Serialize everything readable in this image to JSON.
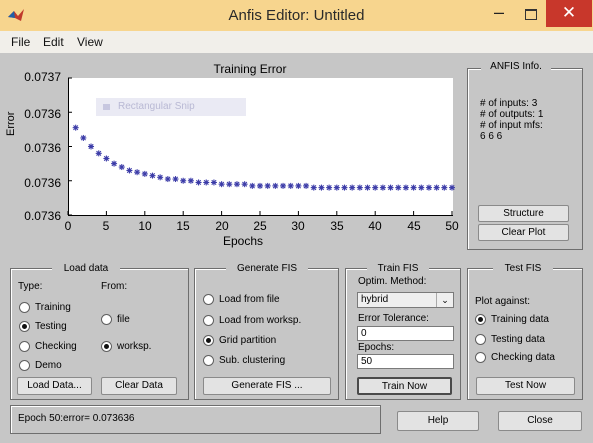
{
  "window": {
    "title": "Anfis Editor: Untitled",
    "minimize_glyph": "–",
    "close_glyph": "✕"
  },
  "menu": [
    "File",
    "Edit",
    "View"
  ],
  "colors": {
    "titlebar": "#f7d58e",
    "close": "#c8372b",
    "marker": "#3c3ca8",
    "background": "#c6c6c6"
  },
  "snip_overlay": {
    "label": "Rectangular Snip"
  },
  "chart_data": {
    "type": "scatter",
    "title": "Training Error",
    "xlabel": "Epochs",
    "ylabel": "Error",
    "xlim": [
      0,
      50
    ],
    "x_ticks": [
      "0",
      "5",
      "10",
      "15",
      "20",
      "25",
      "30",
      "35",
      "40",
      "45",
      "50"
    ],
    "y_tick_labels": [
      "0.0737",
      "0.0736",
      "0.0736",
      "0.0736",
      "0.0736"
    ],
    "ylim": [
      0.0736,
      0.07368
    ],
    "marker": "asterisk",
    "series": [
      {
        "x": [
          1,
          2,
          3,
          4,
          5,
          6,
          7,
          8,
          9,
          10,
          11,
          12,
          13,
          14,
          15,
          16,
          17,
          18,
          19,
          20,
          21,
          22,
          23,
          24,
          25,
          26,
          27,
          28,
          29,
          30,
          31,
          32,
          33,
          34,
          35,
          36,
          37,
          38,
          39,
          40,
          41,
          42,
          43,
          44,
          45,
          46,
          47,
          48,
          49,
          50
        ],
        "y": [
          0.073651,
          0.073645,
          0.07364,
          0.073636,
          0.073633,
          0.07363,
          0.073628,
          0.073626,
          0.073625,
          0.073624,
          0.073623,
          0.073622,
          0.073621,
          0.073621,
          0.07362,
          0.07362,
          0.073619,
          0.073619,
          0.073619,
          0.073618,
          0.073618,
          0.073618,
          0.073618,
          0.073617,
          0.073617,
          0.073617,
          0.073617,
          0.073617,
          0.073617,
          0.073617,
          0.073617,
          0.073616,
          0.073616,
          0.073616,
          0.073616,
          0.073616,
          0.073616,
          0.073616,
          0.073616,
          0.073616,
          0.073616,
          0.073616,
          0.073616,
          0.073616,
          0.073616,
          0.073616,
          0.073616,
          0.073616,
          0.073616,
          0.073616
        ]
      }
    ]
  },
  "anfis_info": {
    "title": "ANFIS Info.",
    "lines": [
      "# of inputs: 3",
      "# of outputs: 1",
      "# of input mfs:",
      "6 6 6"
    ],
    "structure_button": "Structure",
    "clear_plot_button": "Clear Plot"
  },
  "load_data": {
    "title": "Load data",
    "type_label": "Type:",
    "from_label": "From:",
    "types": [
      "Training",
      "Testing",
      "Checking",
      "Demo"
    ],
    "selected_type": "Testing",
    "sources": [
      "file",
      "worksp."
    ],
    "selected_source": "worksp.",
    "load_button": "Load Data...",
    "clear_button": "Clear Data"
  },
  "generate_fis": {
    "title": "Generate FIS",
    "options": [
      "Load from file",
      "Load from worksp.",
      "Grid partition",
      "Sub. clustering"
    ],
    "selected": "Grid partition",
    "button": "Generate FIS ..."
  },
  "train_fis": {
    "title": "Train FIS",
    "method_label": "Optim. Method:",
    "method_value": "hybrid",
    "tolerance_label": "Error Tolerance:",
    "tolerance_value": "0",
    "epochs_label": "Epochs:",
    "epochs_value": "50",
    "button": "Train Now"
  },
  "test_fis": {
    "title": "Test FIS",
    "plot_against_label": "Plot against:",
    "options": [
      "Training data",
      "Testing data",
      "Checking data"
    ],
    "selected": "Training data",
    "button": "Test Now"
  },
  "status": {
    "text": "Epoch 50:error= 0.073636"
  },
  "bottom_buttons": {
    "help": "Help",
    "close": "Close"
  }
}
